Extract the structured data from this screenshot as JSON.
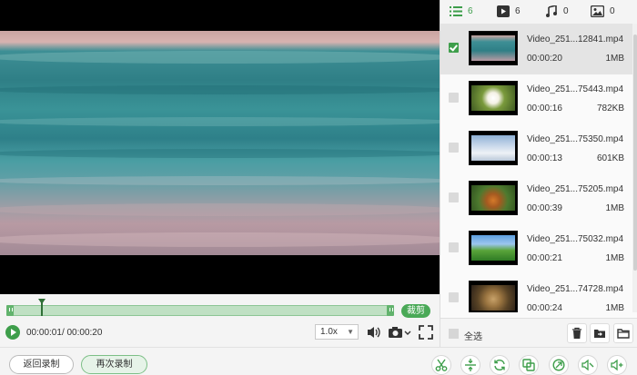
{
  "player": {
    "current_time": "00:00:01",
    "total_time": "/ 00:00:20",
    "speed": "1.0x",
    "cut_label": "裁剪",
    "playhead_fraction": 0.09
  },
  "tabs": [
    {
      "icon": "list-icon",
      "count": "6"
    },
    {
      "icon": "video-icon",
      "count": "6"
    },
    {
      "icon": "music-icon",
      "count": "0"
    },
    {
      "icon": "image-icon",
      "count": "0"
    }
  ],
  "files": [
    {
      "name": "Video_251...12841.mp4",
      "duration": "00:00:20",
      "size": "1MB",
      "checked": true,
      "thumb": "sea"
    },
    {
      "name": "Video_251...75443.mp4",
      "duration": "00:00:16",
      "size": "782KB",
      "checked": false,
      "thumb": "flower"
    },
    {
      "name": "Video_251...75350.mp4",
      "duration": "00:00:13",
      "size": "601KB",
      "checked": false,
      "thumb": "clouds"
    },
    {
      "name": "Video_251...75205.mp4",
      "duration": "00:00:39",
      "size": "1MB",
      "checked": false,
      "thumb": "tiger"
    },
    {
      "name": "Video_251...75032.mp4",
      "duration": "00:00:21",
      "size": "1MB",
      "checked": false,
      "thumb": "field"
    },
    {
      "name": "Video_251...74728.mp4",
      "duration": "00:00:24",
      "size": "1MB",
      "checked": false,
      "thumb": "cat"
    }
  ],
  "footer": {
    "select_all": "全选"
  },
  "bottom": {
    "back_label": "返回录制",
    "again_label": "再次录制"
  },
  "colors": {
    "accent": "#3e9e4b"
  }
}
